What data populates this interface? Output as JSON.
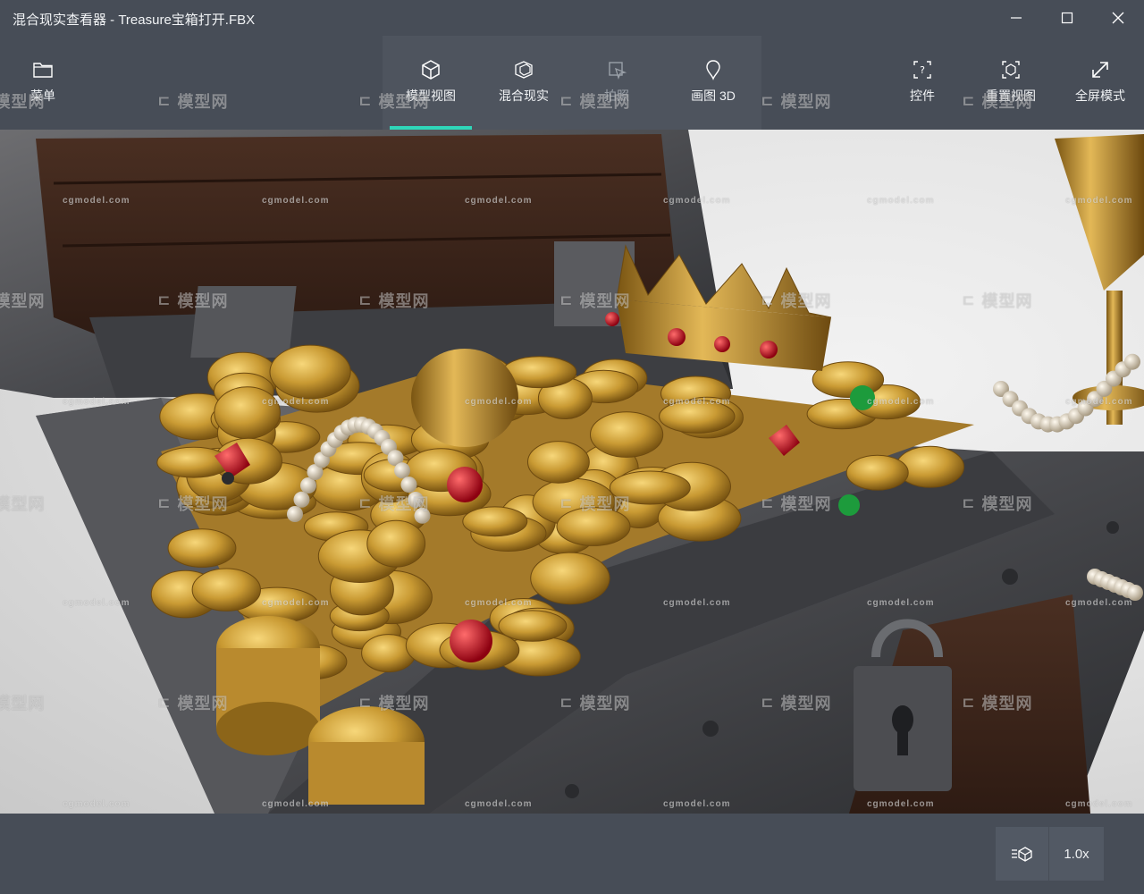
{
  "window": {
    "title": "混合现实查看器 - Treasure宝箱打开.FBX"
  },
  "toolbar": {
    "menu_label": "菜单",
    "modes": [
      {
        "label": "模型视图",
        "icon": "cube-icon",
        "active": true
      },
      {
        "label": "混合现实",
        "icon": "mixed-reality-icon",
        "active": false
      },
      {
        "label": "拍照",
        "icon": "capture-icon",
        "active": false,
        "disabled": true
      },
      {
        "label": "画图 3D",
        "icon": "paint3d-icon",
        "active": false
      }
    ],
    "controls_label": "控件",
    "reset_view_label": "重置视图",
    "fullscreen_label": "全屏模式",
    "accent_color": "#2fd6b9"
  },
  "watermark": {
    "brand": "模型网",
    "url": "cgmodel.com"
  },
  "statusbar": {
    "speed_label": "1.0x"
  }
}
